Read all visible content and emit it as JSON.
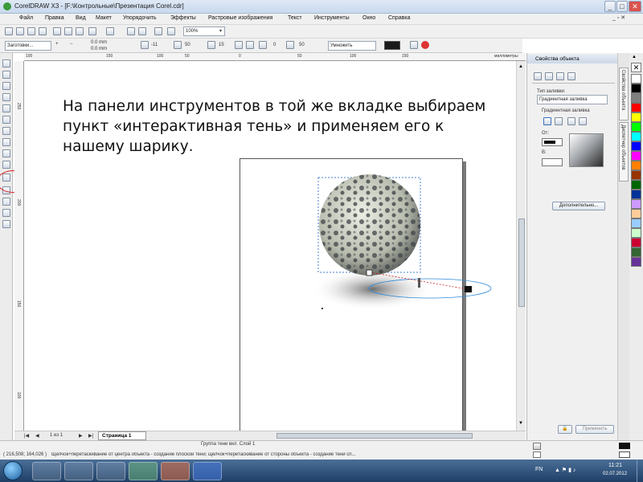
{
  "window": {
    "title": "CorelDRAW X3 - [F:\\Контрольные\\Презентация Corel.cdr]"
  },
  "menu": [
    "Файл",
    "Правка",
    "Вид",
    "Макет",
    "Упорядочить",
    "Эффекты",
    "Растровые изображения",
    "Текст",
    "Инструменты",
    "Окно",
    "Справка"
  ],
  "toolbar": {
    "zoom": "100%"
  },
  "property_bar": {
    "preset": "Заготовки...",
    "add": "+",
    "remove": "−",
    "pos_x": "0.0 mm",
    "pos_y": "0.0 mm",
    "direction": "-11",
    "opacity": "50",
    "feather": "15",
    "fade": "0",
    "stretch": "50",
    "operation": "Умножить"
  },
  "ruler": {
    "unit": "миллиметры",
    "h_labels": [
      "100",
      "150",
      "100",
      "50",
      "0",
      "50",
      "100",
      "150"
    ],
    "v_labels": [
      "250",
      "200",
      "150",
      "100"
    ]
  },
  "canvas": {
    "annotation": "На панели инструментов в той же вкладке выбираем пункт «интерактивная тень» и применяем его к нашему шарику."
  },
  "page_nav": {
    "counter": "1 из 1",
    "page_tab": "Страница 1"
  },
  "status": {
    "object_info": "Группа тени вкл. Слой 1",
    "coords": "( 216,508; 164,026 )",
    "hint": "Щелчок+перетаскивание от центра объекта - создание плоской тени; щелчок+перетаскивание от стороны объекта - создание тени сп..."
  },
  "docker": {
    "title": "Свойства объекта",
    "fill_type_label": "Тип заливки:",
    "fill_type": "Градиентная заливка",
    "gradient_label": "Градиентная заливка",
    "from_label": "От:",
    "to_label": "В:",
    "more_button": "Дополнительно...",
    "apply_button": "Применить"
  },
  "side_tabs": [
    "Свойства объекта",
    "Диспетчер объектов"
  ],
  "palette_colors": [
    "#ffffff",
    "#000000",
    "#7f7f7f",
    "#ff0000",
    "#ffff00",
    "#00ff00",
    "#00ffff",
    "#0000ff",
    "#ff00ff",
    "#ff7f00",
    "#993300",
    "#006600",
    "#003399",
    "#cc99ff",
    "#ffcc99",
    "#99ccff",
    "#ccffcc",
    "#cc0033",
    "#336633",
    "#663399"
  ],
  "taskbar": {
    "lang": "FN",
    "time": "11:21",
    "date": "02.07.2012"
  }
}
